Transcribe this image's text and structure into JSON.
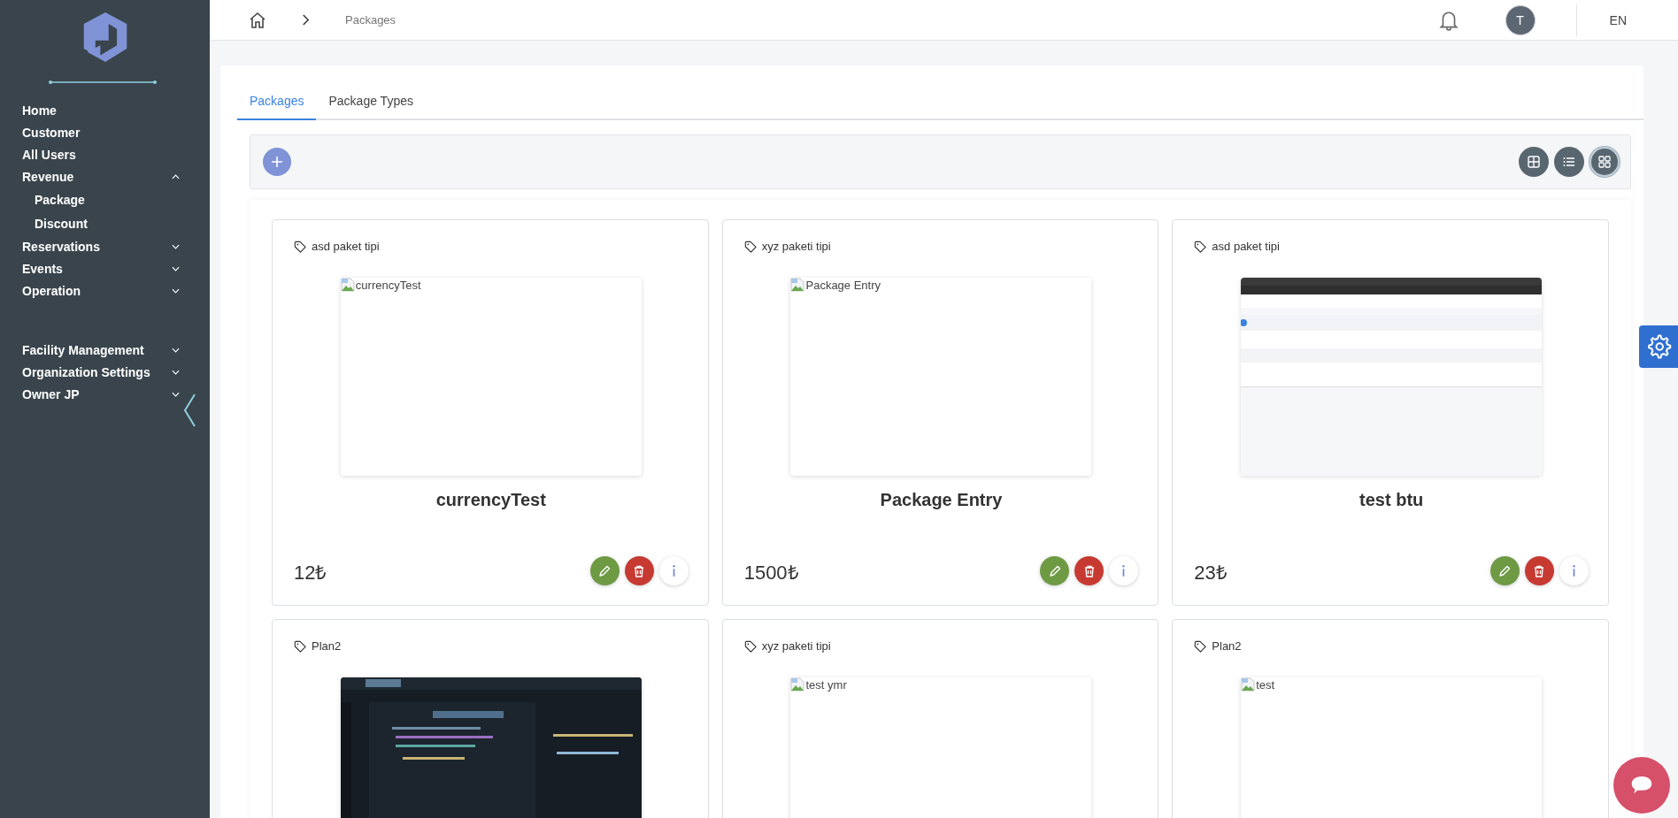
{
  "sidebar": {
    "sections": [
      {
        "items": [
          {
            "label": "Home",
            "kind": "link"
          },
          {
            "label": "Customer",
            "kind": "link"
          },
          {
            "label": "All Users",
            "kind": "link"
          },
          {
            "label": "Revenue",
            "kind": "group",
            "expanded": true,
            "children": [
              {
                "label": "Package"
              },
              {
                "label": "Discount"
              }
            ]
          },
          {
            "label": "Reservations",
            "kind": "group",
            "expanded": false
          },
          {
            "label": "Events",
            "kind": "group",
            "expanded": false
          },
          {
            "label": "Operation",
            "kind": "group",
            "expanded": false
          }
        ]
      },
      {
        "items": [
          {
            "label": "Facility Management",
            "kind": "group",
            "expanded": false
          },
          {
            "label": "Organization Settings",
            "kind": "group",
            "expanded": false
          },
          {
            "label": "Owner JP",
            "kind": "group",
            "expanded": false
          }
        ]
      }
    ]
  },
  "breadcrumb": [
    "Packages"
  ],
  "user": {
    "initial": "T"
  },
  "language": "EN",
  "tabs": [
    {
      "label": "Packages",
      "selected": true
    },
    {
      "label": "Package Types",
      "selected": false
    }
  ],
  "view_buttons": [
    {
      "kind": "table",
      "selected": false
    },
    {
      "kind": "list",
      "selected": false
    },
    {
      "kind": "cards",
      "selected": true
    }
  ],
  "cards": [
    {
      "type_label": "asd paket tipi",
      "image": {
        "kind": "broken",
        "alt": "currencyTest"
      },
      "title": "currencyTest",
      "price": "12₺"
    },
    {
      "type_label": "xyz paketi tipi",
      "image": {
        "kind": "broken",
        "alt": "Package Entry"
      },
      "title": "Package Entry",
      "price": "1500₺"
    },
    {
      "type_label": "asd paket tipi",
      "title": "test btu",
      "price": "23₺"
    },
    {
      "type_label": "Plan2"
    },
    {
      "type_label": "xyz paketi tipi",
      "image": {
        "kind": "broken",
        "alt": "test ymr"
      }
    },
    {
      "type_label": "Plan2",
      "image": {
        "kind": "broken",
        "alt": "test"
      }
    }
  ]
}
